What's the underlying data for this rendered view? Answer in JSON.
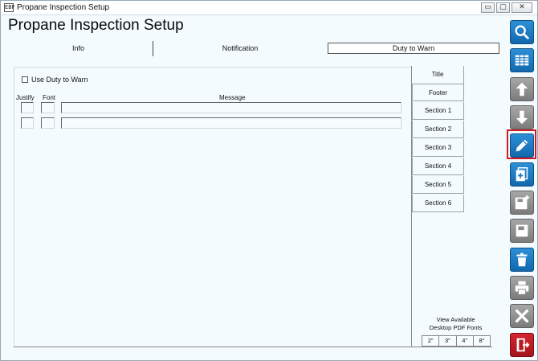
{
  "window": {
    "title": "Propane Inspection Setup",
    "app_icon_text": "EBF",
    "controls": {
      "minimize": "▭",
      "maximize": "▢",
      "close": "✕"
    }
  },
  "page_title": "Propane Inspection Setup",
  "tabs": {
    "info": "Info",
    "notification": "Notification",
    "duty_to_warn": "Duty to Warn"
  },
  "form": {
    "use_duty_to_warn_label": "Use Duty to Warn",
    "use_duty_to_warn_checked": false,
    "columns": {
      "justify": "Justify",
      "font": "Font",
      "message": "Message"
    },
    "rows": [
      {
        "justify": "",
        "font": "",
        "message": ""
      },
      {
        "justify": "",
        "font": "",
        "message": ""
      }
    ]
  },
  "sections": [
    "Title",
    "Footer",
    "Section 1",
    "Section 2",
    "Section 3",
    "Section 4",
    "Section 5",
    "Section 6"
  ],
  "pdf_fonts": {
    "label_line1": "View Available",
    "label_line2": "Desktop PDF Fonts",
    "sizes": [
      "2\"",
      "3\"",
      "4\"",
      "8\""
    ]
  },
  "toolbar": {
    "items": [
      {
        "icon": "search-icon",
        "color": "blue"
      },
      {
        "icon": "table-grid-icon",
        "color": "blue"
      },
      {
        "icon": "arrow-up-icon",
        "color": "gray"
      },
      {
        "icon": "arrow-down-icon",
        "color": "gray"
      },
      {
        "icon": "pencil-edit-icon",
        "color": "blue",
        "highlighted": true
      },
      {
        "icon": "add-document-icon",
        "color": "blue"
      },
      {
        "icon": "save-new-icon",
        "color": "gray"
      },
      {
        "icon": "save-icon",
        "color": "gray"
      },
      {
        "icon": "trash-icon",
        "color": "blue"
      },
      {
        "icon": "print-icon",
        "color": "gray"
      },
      {
        "icon": "cancel-x-icon",
        "color": "gray"
      },
      {
        "icon": "exit-door-icon",
        "color": "red"
      }
    ],
    "colors": {
      "blue": "#1a78c2",
      "gray": "#8a8a8a",
      "red": "#b81a22",
      "highlight": "#d11c24"
    }
  }
}
